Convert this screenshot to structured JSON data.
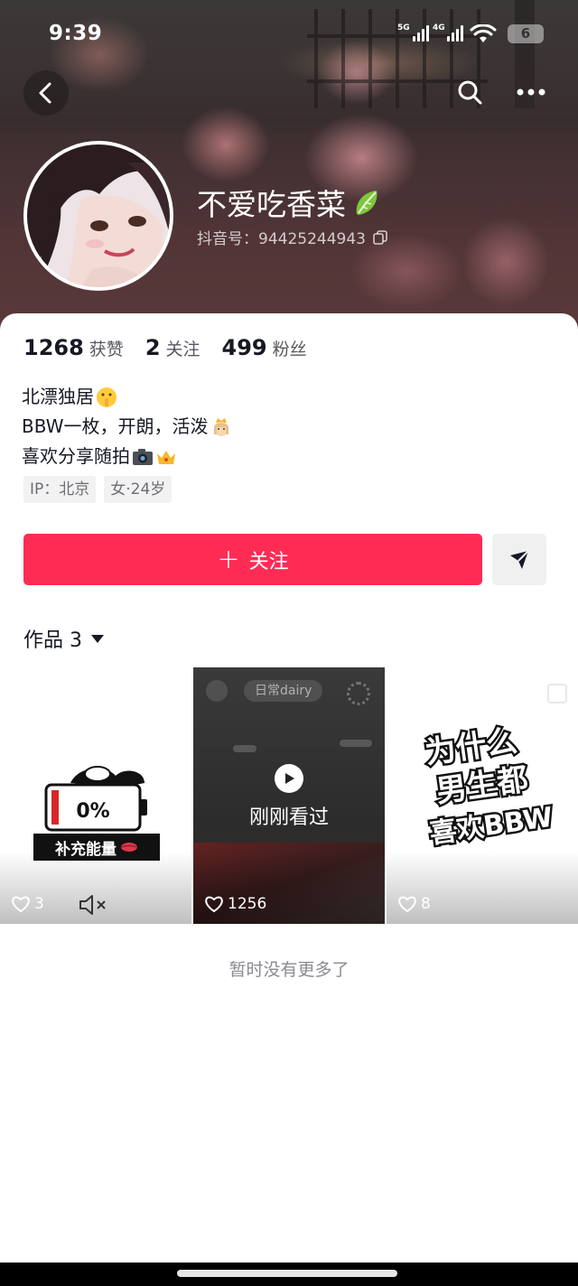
{
  "status_bar": {
    "time": "9:39",
    "signal_1": "5G",
    "signal_2": "4G",
    "battery": "6"
  },
  "profile": {
    "nickname": "不爱吃香菜",
    "nickname_emoji": "lettuce-emoji",
    "douyin_id": "抖音号：94425244943"
  },
  "stats": [
    {
      "value": "1268",
      "label": "获赞"
    },
    {
      "value": "2",
      "label": "关注"
    },
    {
      "value": "499",
      "label": "粉丝"
    }
  ],
  "bio": {
    "line1": "北漂独居",
    "line1_emoji": "shushing-face-emoji",
    "line2": "BBW一枚，开朗，活泼",
    "line2_emoji": "princess-emoji",
    "line3": "喜欢分享随拍",
    "line3_emoji": [
      "camera-emoji",
      "crown-emoji"
    ]
  },
  "tags": [
    "IP：北京",
    "女·24岁"
  ],
  "actions": {
    "follow_label": "关注",
    "follow_color": "#fe2c55"
  },
  "works": {
    "tab_label": "作品 3"
  },
  "videos": [
    {
      "likes": "3",
      "caption": "补充能量",
      "battery_text": "0%"
    },
    {
      "likes": "1256",
      "pill_text": "日常dairy",
      "overlay": "刚刚看过"
    },
    {
      "likes": "8",
      "title_lines": [
        "为什么",
        "男生都",
        "喜欢BBW"
      ]
    }
  ],
  "footer": {
    "no_more": "暂时没有更多了"
  }
}
